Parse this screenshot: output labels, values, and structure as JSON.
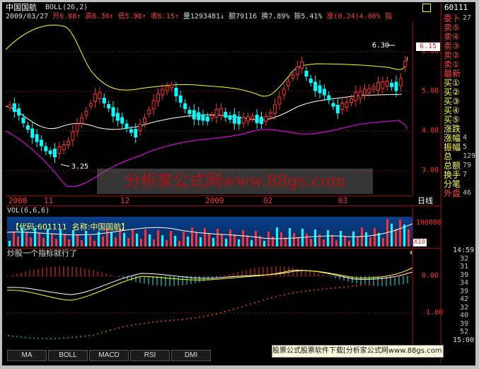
{
  "header": {
    "stock_name": "中国国航",
    "indicator": "BOLL(26,2)",
    "date": "2009/03/27",
    "open_label": "开6.08",
    "high_label": "高6.30",
    "low_label": "低5.98",
    "close_label": "收6.15",
    "volume_label": "量1293481",
    "amount_label": "额79116",
    "turnover_label": "换7.89%",
    "amplitude_label": "振5.41%",
    "change_label": "涨(0.24)4.06%",
    "index_label": "指"
  },
  "main_chart": {
    "price_axis": [
      "6.00",
      "5.00",
      "4.00",
      "3.00"
    ],
    "current_price": "6.15",
    "high_marker": "6.30",
    "low_marker": "3.25",
    "time_axis": [
      "2008",
      "11",
      "12",
      "2009",
      "02",
      "03"
    ],
    "period_label": "日线",
    "colors": {
      "up": "#ff3030",
      "down": "#00ffff",
      "mid": "#ffffff",
      "upper": "#ffff00",
      "lower": "#ff00ff"
    }
  },
  "volume_panel": {
    "title": "VOL(6,6,6)",
    "info": "【代码:601111  名称:中国国航】",
    "axis_label": "100000",
    "unit": "X10"
  },
  "indicator_panel": {
    "title": "炒股一个指标就行了",
    "axis": [
      "0.00",
      "0.00",
      "-1.00"
    ]
  },
  "watermark": "分析家公式网www.88gs.com",
  "right_panel": {
    "code": "60111",
    "items": [
      {
        "label": "委卜",
        "value": "27"
      },
      {
        "label": "卖⑤",
        "value": ""
      },
      {
        "label": "卖④",
        "value": ""
      },
      {
        "label": "卖③",
        "value": ""
      },
      {
        "label": "卖②",
        "value": ""
      },
      {
        "label": "卖①",
        "value": ""
      },
      {
        "label": "最新",
        "value": ""
      },
      {
        "label": "买①",
        "value": ""
      },
      {
        "label": "买②",
        "value": ""
      },
      {
        "label": "买③",
        "value": ""
      },
      {
        "label": "买④",
        "value": ""
      },
      {
        "label": "买⑤",
        "value": ""
      },
      {
        "label": "涨跌",
        "value": ""
      },
      {
        "label": "涨幅",
        "value": "4"
      },
      {
        "label": "振幅",
        "value": "5"
      },
      {
        "label": "总",
        "value": "129"
      },
      {
        "label": "总额",
        "value": "79"
      },
      {
        "label": "换手",
        "value": "7"
      },
      {
        "label": "分笔",
        "value": ""
      },
      {
        "label": "外盘",
        "value": "46"
      }
    ],
    "ticks": [
      {
        "time": "14:59",
        "value": ""
      },
      {
        "time": "",
        "value": "32"
      },
      {
        "time": "",
        "value": "31"
      },
      {
        "time": "",
        "value": "39"
      },
      {
        "time": "",
        "value": "34"
      },
      {
        "time": "",
        "value": "39"
      },
      {
        "time": "",
        "value": "42"
      },
      {
        "time": "",
        "value": "32"
      },
      {
        "time": "",
        "value": "40"
      },
      {
        "time": "",
        "value": "39"
      },
      {
        "time": "",
        "value": "52"
      },
      {
        "time": "15:00",
        "value": ""
      }
    ]
  },
  "tabs": [
    "MA",
    "BOLL",
    "MACD",
    "RSI",
    "DMI"
  ],
  "footer_banner": "股票公式股票软件下载[分析家公式网www.88gs.com]"
}
